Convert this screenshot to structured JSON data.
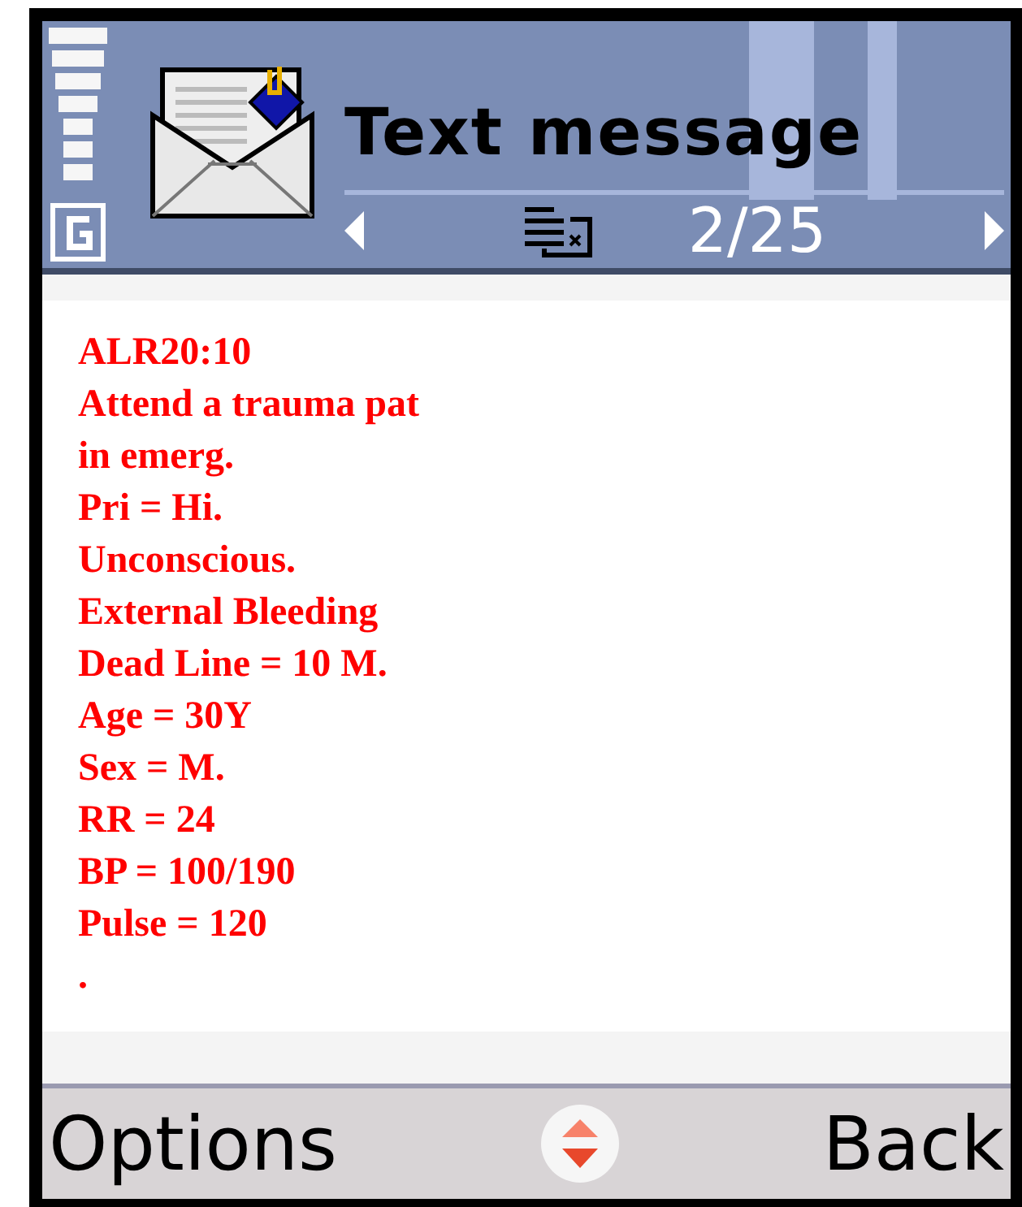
{
  "header": {
    "title": "Text message",
    "counter": "2/25"
  },
  "message": {
    "lines": [
      "ALR20:10",
      "Attend a trauma pat",
      "in emerg.",
      "Pri = Hi.",
      "Unconscious.",
      "External Bleeding",
      "Dead Line = 10 M.",
      "Age = 30Y",
      "Sex = M.",
      "RR = 24",
      "BP = 100/190",
      "Pulse = 120",
      "."
    ]
  },
  "softkeys": {
    "left": "Options",
    "right": "Back"
  }
}
